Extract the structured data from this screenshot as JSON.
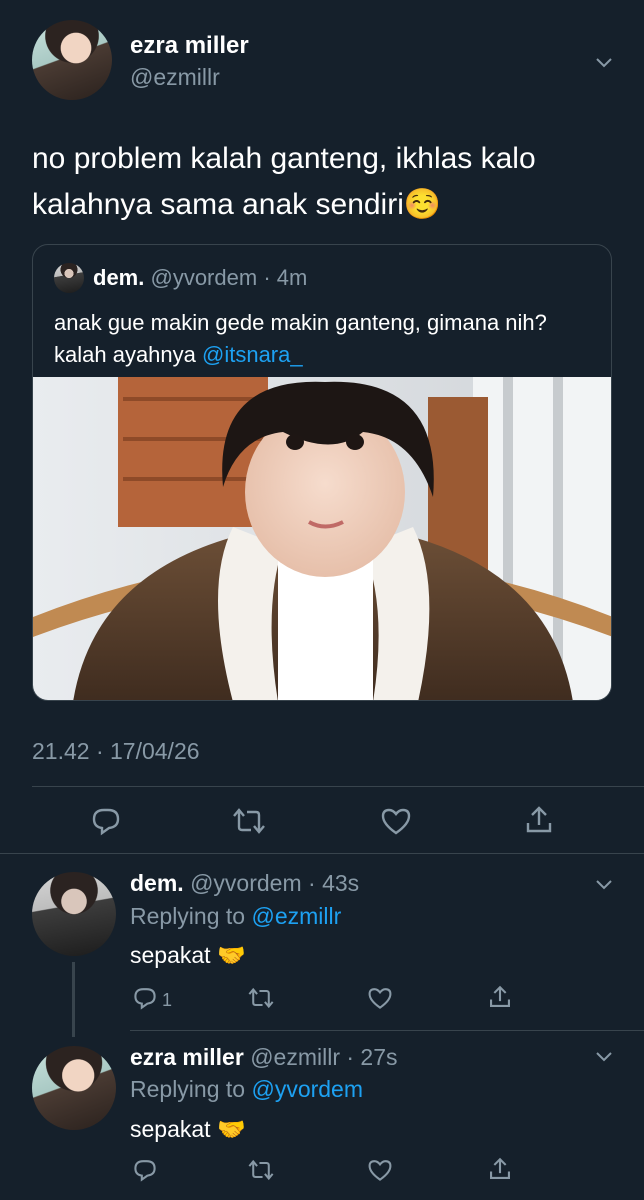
{
  "main_tweet": {
    "display_name": "ezra miller",
    "handle": "@ezmillr",
    "text": "no problem kalah ganteng, ikhlas kalo kalahnya sama anak sendiri☺️",
    "timestamp": "21.42 · 17/04/26"
  },
  "quoted_tweet": {
    "display_name": "dem.",
    "handle": "@yvordem",
    "age": "· 4m",
    "text_before_mention": "anak gue makin gede makin ganteng, gimana nih? kalah ayahnya ",
    "mention": "@itsnara_"
  },
  "replies": [
    {
      "display_name": "dem.",
      "handle": "@yvordem",
      "age": "· 43s",
      "replying_prefix": "Replying to ",
      "replying_to": "@ezmillr",
      "text": "sepakat 🤝",
      "reply_count": "1"
    },
    {
      "display_name": "ezra miller",
      "handle": "@ezmillr",
      "age": "· 27s",
      "replying_prefix": "Replying to ",
      "replying_to": "@yvordem",
      "text": "sepakat 🤝",
      "reply_count": ""
    }
  ],
  "colors": {
    "background": "#15202b",
    "muted": "#8899a6",
    "link": "#1da1f2",
    "border": "#38444d"
  }
}
